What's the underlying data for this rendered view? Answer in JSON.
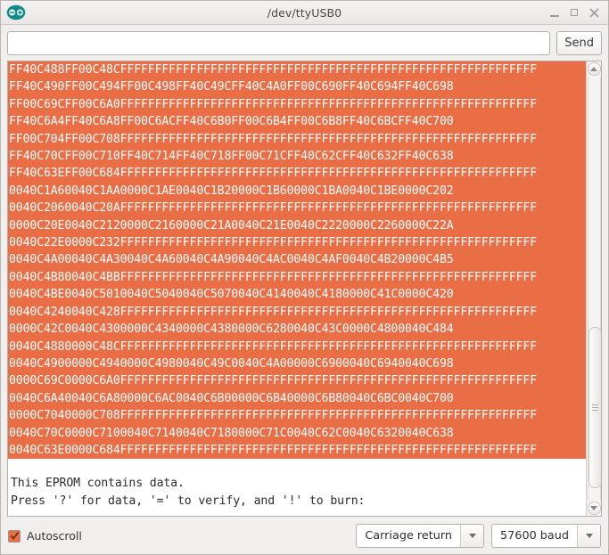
{
  "window": {
    "title": "/dev/ttyUSB0",
    "logo_icon": "arduino-infinity-logo",
    "controls": {
      "minimize": "minimize-icon",
      "maximize": "maximize-icon",
      "close": "close-icon"
    }
  },
  "send_row": {
    "input_value": "",
    "input_placeholder": "",
    "send_label": "Send"
  },
  "console": {
    "hex_lines": [
      "FF40C488FF00C48CFFFFFFFFFFFFFFFFFFFFFFFFFFFFFFFFFFFFFFFFFFFFFFFFFFFFFFFFFFFF",
      "FF40C490FF00C494FF00C498FF40C49CFF40C4A0FF00C690FF40C694FF40C698",
      "FF00C69CFF00C6A0FFFFFFFFFFFFFFFFFFFFFFFFFFFFFFFFFFFFFFFFFFFFFFFFFFFFFFFFFFFF",
      "FF40C6A4FF40C6A8FF00C6ACFF40C6B0FF00C6B4FF00C6B8FF40C6BCFF40C700",
      "FF00C704FF00C708FFFFFFFFFFFFFFFFFFFFFFFFFFFFFFFFFFFFFFFFFFFFFFFFFFFFFFFFFFFF",
      "FF40C70CFF00C710FF40C714FF40C718FF00C71CFF40C62CFF40C632FF40C638",
      "FF40C63EFF00C684FFFFFFFFFFFFFFFFFFFFFFFFFFFFFFFFFFFFFFFFFFFFFFFFFFFFFFFFFFFF",
      "0040C1A60040C1AA0000C1AE0040C1B20000C1B60000C1BA0040C1BE0000C202",
      "0040C2060040C20AFFFFFFFFFFFFFFFFFFFFFFFFFFFFFFFFFFFFFFFFFFFFFFFFFFFFFFFFFFFF",
      "0000C20E0040C2120000C2160000C21A0040C21E0040C2220000C2260000C22A",
      "0040C22E0000C232FFFFFFFFFFFFFFFFFFFFFFFFFFFFFFFFFFFFFFFFFFFFFFFFFFFFFFFFFFFF",
      "0040C4A00040C4A30040C4A60040C4A90040C4AC0040C4AF0040C4B20000C4B5",
      "0040C4B80040C4BBFFFFFFFFFFFFFFFFFFFFFFFFFFFFFFFFFFFFFFFFFFFFFFFFFFFFFFFFFFFF",
      "0040C4BE0040C5010040C5040040C5070040C4140040C4180000C41C0000C420",
      "0040C4240040C428FFFFFFFFFFFFFFFFFFFFFFFFFFFFFFFFFFFFFFFFFFFFFFFFFFFFFFFFFFFF",
      "0000C42C0040C4300000C4340000C4380000C6280040C43C0000C4800040C484",
      "0040C4880000C48CFFFFFFFFFFFFFFFFFFFFFFFFFFFFFFFFFFFFFFFFFFFFFFFFFFFFFFFFFFFF",
      "0040C4900000C4940000C4980040C49C0040C4A00000C6900040C6940040C698",
      "0000C69C0000C6A0FFFFFFFFFFFFFFFFFFFFFFFFFFFFFFFFFFFFFFFFFFFFFFFFFFFFFFFFFFFF",
      "0040C6A40040C6A80000C6AC0040C6B00000C6B40000C6B80040C6BC0040C700",
      "0000C7040000C708FFFFFFFFFFFFFFFFFFFFFFFFFFFFFFFFFFFFFFFFFFFFFFFFFFFFFFFFFFFF",
      "0040C70C0000C7100040C7140040C7180000C71C0040C62C0040C6320040C638",
      "0040C63E0000C684FFFFFFFFFFFFFFFFFFFFFFFFFFFFFFFFFFFFFFFFFFFFFFFFFFFFFFFFFFFF"
    ],
    "message_lines": [
      "This EPROM contains data.",
      "Press '?' for data, '=' to verify, and '!' to burn:"
    ],
    "hex_background": "#EA6E45",
    "hex_text_color": "#FFFFFF",
    "message_text_color": "#2C2C2C"
  },
  "scrollbar": {
    "up_arrow_icon": "triangle-up-icon",
    "down_arrow_icon": "triangle-down-icon",
    "thumb_top_pct": 59,
    "thumb_height_pct": 38,
    "grip_icon": "grip-lines-icon"
  },
  "bottom_bar": {
    "autoscroll_label": "Autoscroll",
    "autoscroll_checked": true,
    "check_icon": "check-icon",
    "line_ending": {
      "value": "Carriage return",
      "arrow_icon": "chevron-down-icon"
    },
    "baud_rate": {
      "value": "57600 baud",
      "arrow_icon": "chevron-down-icon"
    }
  }
}
